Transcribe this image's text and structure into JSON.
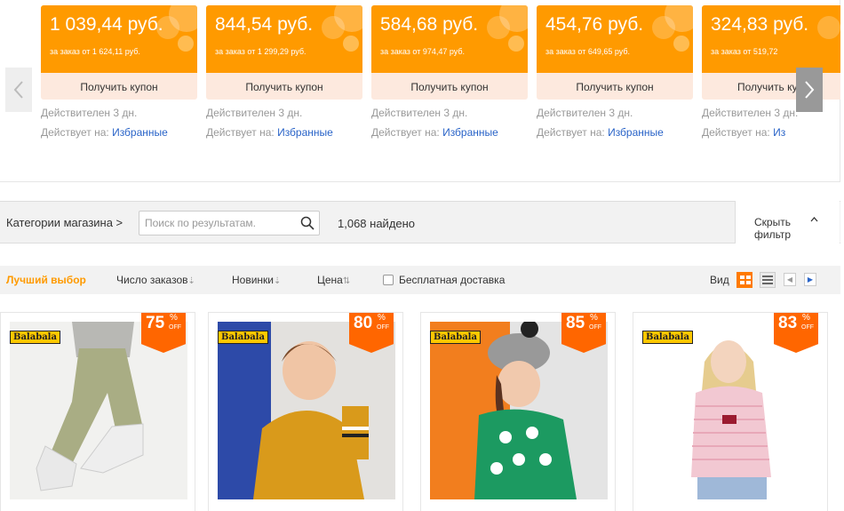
{
  "coupons": [
    {
      "amount": "1 039,44 руб.",
      "condition": "за заказ от 1 624,11 руб.",
      "button": "Получить купон",
      "valid": "Действителен 3 дн.",
      "scope_label": "Действует на:",
      "scope_link": "Избранные"
    },
    {
      "amount": "844,54 руб.",
      "condition": "за заказ от 1 299,29 руб.",
      "button": "Получить купон",
      "valid": "Действителен 3 дн.",
      "scope_label": "Действует на:",
      "scope_link": "Избранные"
    },
    {
      "amount": "584,68 руб.",
      "condition": "за заказ от 974,47 руб.",
      "button": "Получить купон",
      "valid": "Действителен 3 дн.",
      "scope_label": "Действует на:",
      "scope_link": "Избранные"
    },
    {
      "amount": "454,76 руб.",
      "condition": "за заказ от 649,65 руб.",
      "button": "Получить купон",
      "valid": "Действителен 3 дн.",
      "scope_label": "Действует на:",
      "scope_link": "Избранные"
    },
    {
      "amount": "324,83 руб.",
      "condition": "за заказ от 519,72",
      "button": "Получить купон",
      "valid": "Действителен 3 дн.",
      "scope_label": "Действует на:",
      "scope_link": "Из"
    }
  ],
  "filter": {
    "categories_label": "Категории магазина >",
    "search_placeholder": "Поиск по результатам.",
    "found_text": "1,068 найдено",
    "hide_filter_label": "Скрыть фильтр"
  },
  "sort": {
    "best": "Лучший выбор",
    "orders": "Число заказов",
    "orders_arrow": "⇣",
    "new": "Новинки",
    "new_arrow": "⇣",
    "price": "Цена",
    "price_arrow": "⇅",
    "free_shipping": "Бесплатная доставка",
    "view_label": "Вид",
    "prev": "◀",
    "next": "▶"
  },
  "products": [
    {
      "brand": "Balabala",
      "discount": "75",
      "percent": "%",
      "off": "OFF"
    },
    {
      "brand": "Balabala",
      "discount": "80",
      "percent": "%",
      "off": "OFF"
    },
    {
      "brand": "Balabala",
      "discount": "85",
      "percent": "%",
      "off": "OFF"
    },
    {
      "brand": "Balabala",
      "discount": "83",
      "percent": "%",
      "off": "OFF"
    }
  ],
  "colors": {
    "accent": "#ff9a00",
    "badge": "#ff6600",
    "link": "#2a64c8"
  }
}
